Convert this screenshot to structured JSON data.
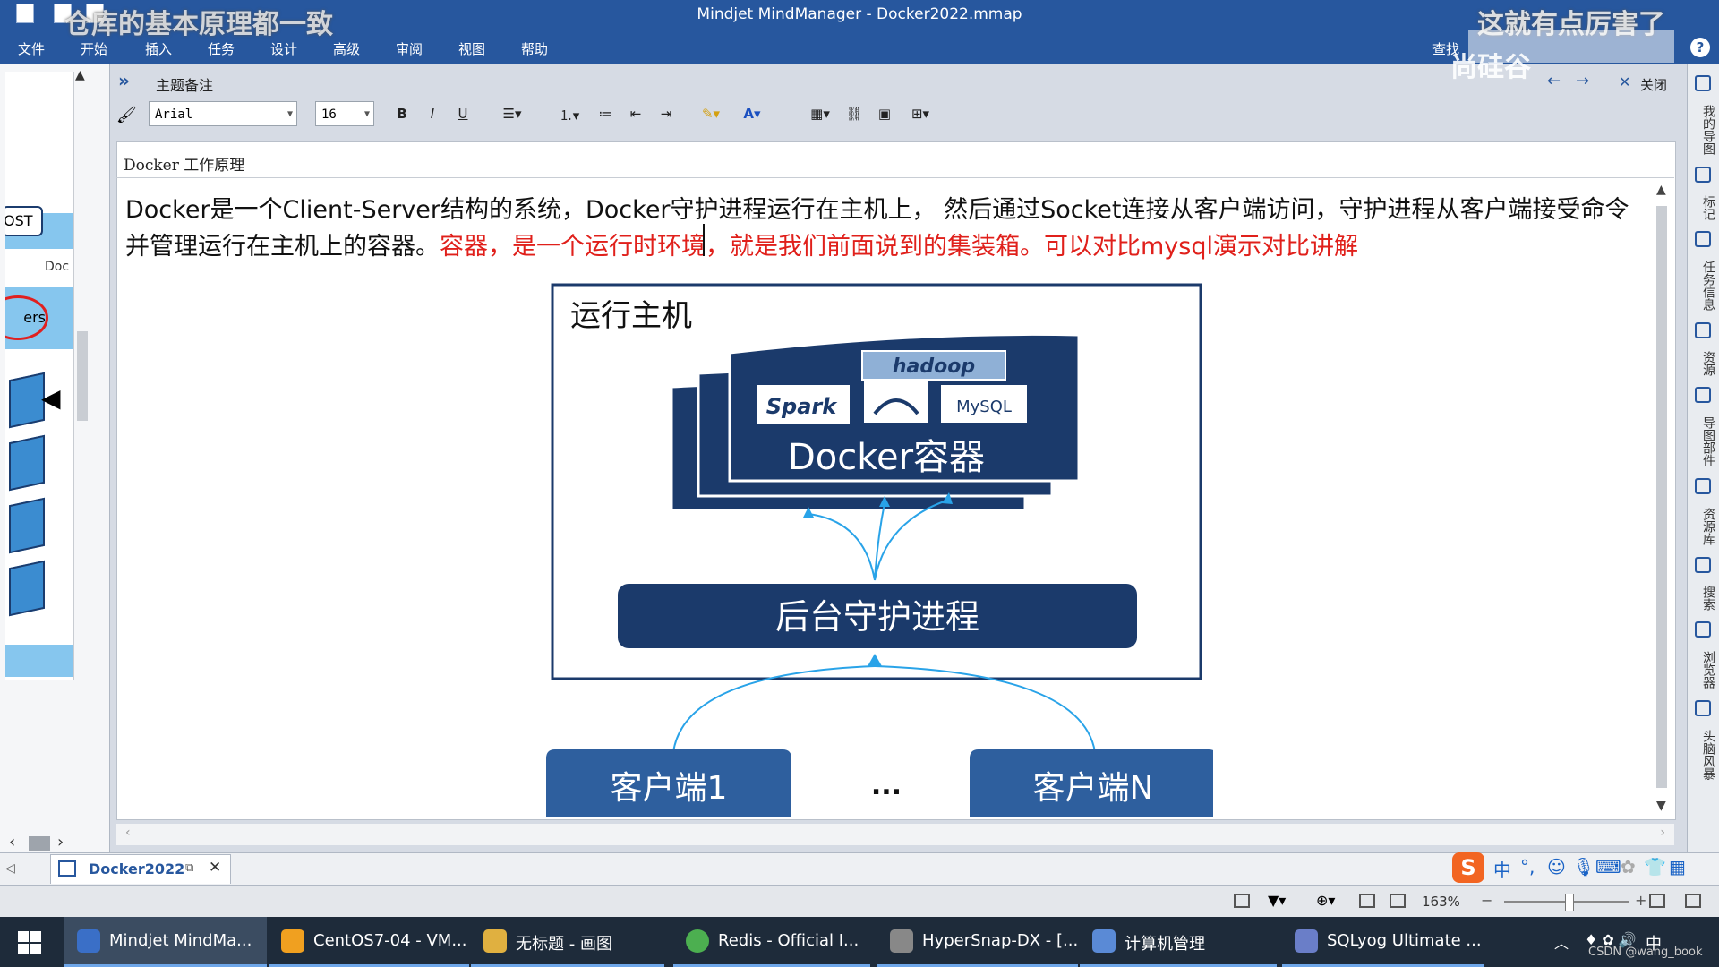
{
  "window": {
    "title": "Mindjet MindManager - Docker2022.mmap",
    "overlay_left": "仓库的基本原理都一致",
    "overlay_right": "这就有点厉害了",
    "watermark": "尚硅谷"
  },
  "ribbon": {
    "tabs": [
      "文件",
      "开始",
      "插入",
      "任务",
      "设计",
      "高级",
      "审阅",
      "视图",
      "帮助"
    ],
    "find_label": "查找",
    "help": "?"
  },
  "notes": {
    "header_title": "主题备注",
    "close_label": "关闭",
    "font_name": "Arial",
    "font_size": "16",
    "bold": "B",
    "italic": "I",
    "underline": "U",
    "topic_title": "Docker 工作原理",
    "body_black": "Docker是一个Client-Server结构的系统，Docker守护进程运行在主机上， 然后通过Socket连接从客户端访问，守护进程从客户端接受命令并管理运行在主机上的容器。",
    "body_red": "容器，是一个运行时环境，就是我们前面说到的集装箱。可以对比mysql演示对比讲解"
  },
  "diagram": {
    "host_label": "运行主机",
    "container_label": "Docker容器",
    "daemon_label": "后台守护进程",
    "client1": "客户端1",
    "clientN": "客户端N",
    "ellipsis": "...",
    "logos": [
      "hadoop",
      "Spark",
      "MySQL"
    ]
  },
  "left_map": {
    "labels": [
      "OST",
      "Doc",
      "ers"
    ]
  },
  "right_dock": {
    "items": [
      "我的导图",
      "标记",
      "任务信息",
      "资源",
      "导图部件",
      "资源库",
      "搜索",
      "浏览器",
      "头脑风暴"
    ]
  },
  "doc_tab": {
    "label": "Docker2022"
  },
  "statusbar": {
    "zoom": "163%"
  },
  "taskbar": {
    "items": [
      {
        "label": "Mindjet MindMa...",
        "color": "#3a6fc7"
      },
      {
        "label": "CentOS7-04 - VM...",
        "color": "#f0a020"
      },
      {
        "label": "无标题 - 画图",
        "color": "#e0b040"
      },
      {
        "label": "Redis - Official I...",
        "color": "#4caf50"
      },
      {
        "label": "HyperSnap-DX - [...",
        "color": "#888888"
      },
      {
        "label": "计算机管理",
        "color": "#5a8ad6"
      },
      {
        "label": "SQLyog Ultimate ...",
        "color": "#6a7ec8"
      }
    ],
    "ime": "中",
    "credit": "CSDN @wang_book"
  },
  "colors": {
    "titlebar": "#27579e",
    "diagram_navy": "#1b3a6b",
    "client_blue": "#2e5f9e",
    "arrow_blue": "#29a3e8",
    "red_text": "#e0201b"
  }
}
